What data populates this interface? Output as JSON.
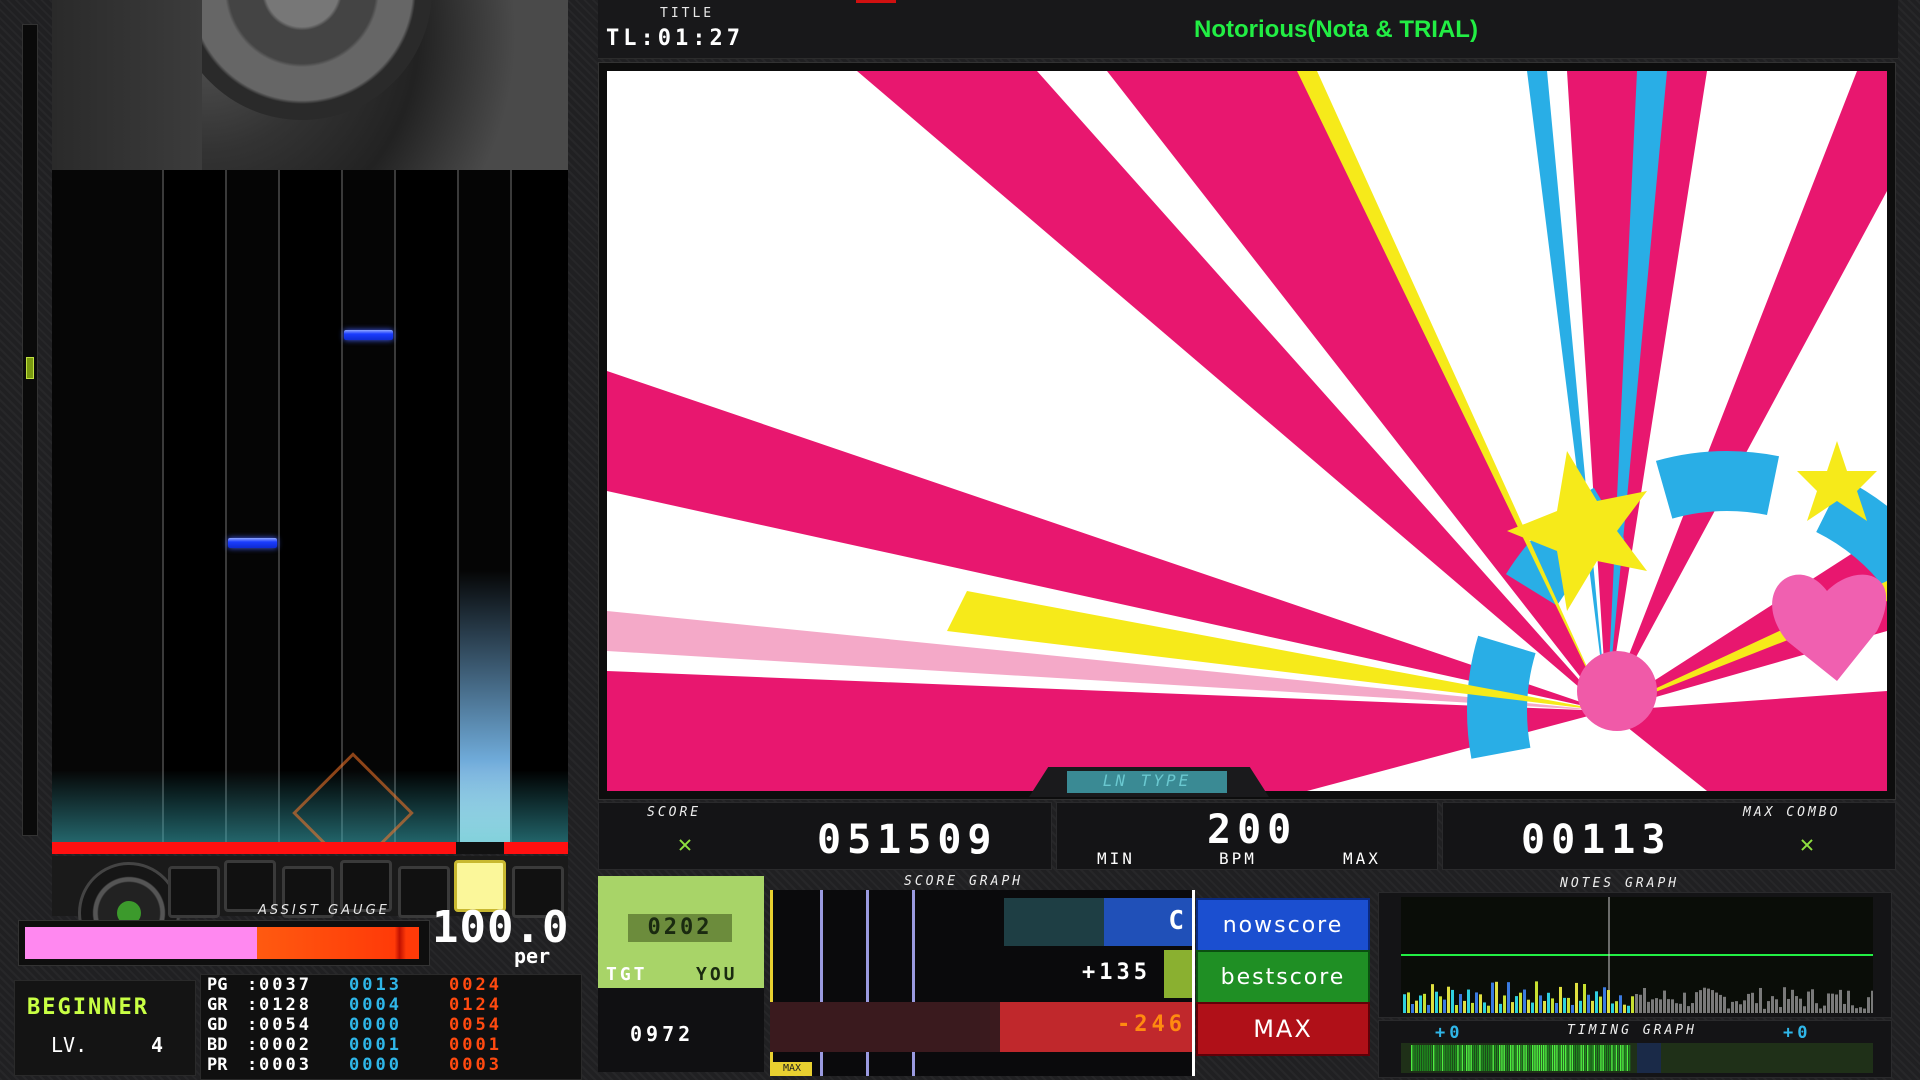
{
  "header": {
    "title_label": "TITLE",
    "timer": "TL:01:27",
    "song_title": "Notorious(Nota & TRIAL)"
  },
  "playfield": {
    "notes_lanes": [
      3,
      6
    ],
    "lit_key": 8
  },
  "bga_label": "LN TYPE",
  "score": {
    "label": "SCORE",
    "value": "051509"
  },
  "bpm": {
    "value": "200",
    "min_label": "MIN",
    "bpm_label": "BPM",
    "max_label": "MAX"
  },
  "max_combo": {
    "label": "MAX COMBO",
    "value": "00113"
  },
  "assist_gauge": {
    "label": "ASSIST GAUGE",
    "value": "100.0",
    "unit": "per",
    "fill_fraction": 1.0
  },
  "difficulty": {
    "name": "BEGINNER",
    "level_label": "LV.",
    "level": "4"
  },
  "judges": [
    {
      "name": "PG",
      "total": "0037",
      "fast": "0013",
      "slow": "0024"
    },
    {
      "name": "GR",
      "total": "0128",
      "fast": "0004",
      "slow": "0124"
    },
    {
      "name": "GD",
      "total": "0054",
      "fast": "0000",
      "slow": "0054"
    },
    {
      "name": "BD",
      "total": "0002",
      "fast": "0001",
      "slow": "0001"
    },
    {
      "name": "PR",
      "total": "0003",
      "fast": "0000",
      "slow": "0003"
    }
  ],
  "target": {
    "score": "0202",
    "tgt_label": "TGT",
    "you_label": "YOU",
    "you_score": "0972"
  },
  "score_graph": {
    "label": "SCORE GRAPH",
    "rank": "C",
    "now_label": "nowscore",
    "best_diff": "+135",
    "best_label": "bestscore",
    "max_diff": "-246",
    "max_label": "MAX",
    "bottom_tag": "MAX"
  },
  "notes_graph": {
    "label": "NOTES GRAPH"
  },
  "timing_graph": {
    "label": "TIMING GRAPH",
    "left_value": "+0",
    "right_value": "+0"
  },
  "colors": {
    "accent_green": "#22ee44",
    "lime": "#c8ff44",
    "pink": "#ff88f0",
    "orange": "#ff4a10",
    "nowscore_blue": "#1b4fd0",
    "bestscore_green": "#1f8f24",
    "max_red": "#b01018"
  }
}
